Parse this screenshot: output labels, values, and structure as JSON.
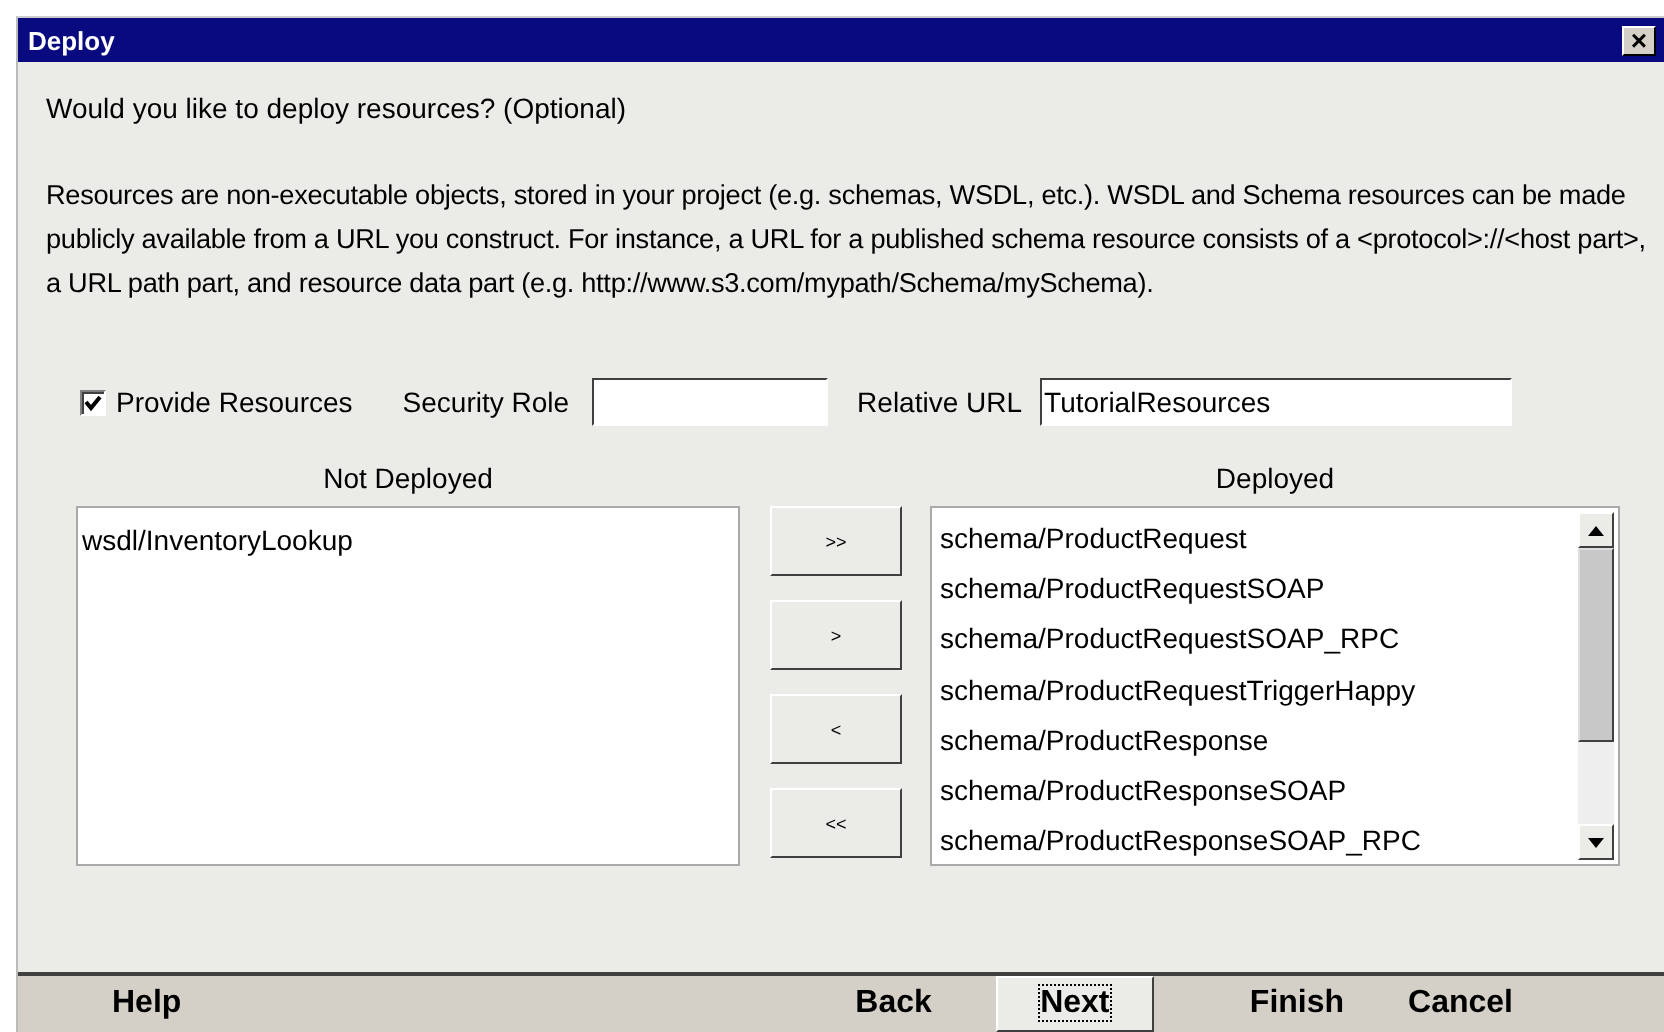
{
  "window": {
    "title": "Deploy",
    "close": "×"
  },
  "question": "Would you like to deploy resources? (Optional)",
  "description": "Resources are non-executable objects, stored in your project (e.g. schemas, WSDL, etc.).  WSDL and Schema resources can be made publicly available from a URL you construct.  For instance, a URL for a published schema resource consists of a <protocol>://<host part>, a URL path part, and resource data part (e.g. http://www.s3.com/mypath/Schema/mySchema).",
  "provide_resources": {
    "label": "Provide Resources",
    "checked": true
  },
  "security_role": {
    "label": "Security Role"
  },
  "relative_url": {
    "label": "Relative URL",
    "value": "TutorialResources"
  },
  "not_deployed": {
    "title": "Not Deployed",
    "items": [
      "wsdl/InventoryLookup"
    ]
  },
  "move_buttons": [
    ">>",
    ">",
    "<",
    "<<"
  ],
  "deployed": {
    "title": "Deployed",
    "items": [
      "schema/ProductRequest",
      "schema/ProductRequestSOAP",
      "schema/ProductRequestSOAP_RPC",
      "schema/ProductRequestTriggerHappy",
      "schema/ProductResponse",
      "schema/ProductResponseSOAP",
      "schema/ProductResponseSOAP_RPC"
    ]
  },
  "footer_buttons": [
    {
      "label": "Help",
      "focused": false
    },
    {
      "label": "Back",
      "focused": false
    },
    {
      "label": "Next",
      "focused": true
    },
    {
      "label": "Finish",
      "focused": false
    },
    {
      "label": "Cancel",
      "focused": false
    }
  ]
}
